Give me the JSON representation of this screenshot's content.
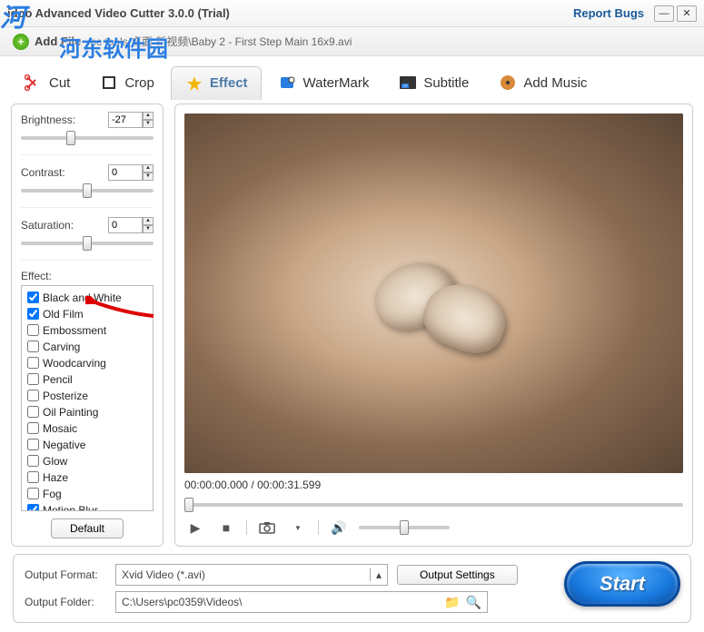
{
  "titlebar": {
    "title": "idoo Advanced Video Cutter 3.0.0 (Trial)",
    "report": "Report Bugs"
  },
  "watermark": {
    "logo": "河",
    "text": "河东软件园"
  },
  "addfile": {
    "label": "Add File",
    "path": "pc tools 桌面 新视频\\Baby 2 - First Step Main 16x9.avi"
  },
  "tabs": {
    "cut": "Cut",
    "crop": "Crop",
    "effect": "Effect",
    "watermark": "WaterMark",
    "subtitle": "Subtitle",
    "addmusic": "Add Music"
  },
  "sliders": {
    "brightness": {
      "label": "Brightness:",
      "value": "-27"
    },
    "contrast": {
      "label": "Contrast:",
      "value": "0"
    },
    "saturation": {
      "label": "Saturation:",
      "value": "0"
    }
  },
  "effect_section": {
    "label": "Effect:",
    "default_btn": "Default",
    "items": [
      {
        "name": "Black and White",
        "checked": true
      },
      {
        "name": "Old Film",
        "checked": true
      },
      {
        "name": "Embossment",
        "checked": false
      },
      {
        "name": "Carving",
        "checked": false
      },
      {
        "name": "Woodcarving",
        "checked": false
      },
      {
        "name": "Pencil",
        "checked": false
      },
      {
        "name": "Posterize",
        "checked": false
      },
      {
        "name": "Oil Painting",
        "checked": false
      },
      {
        "name": "Mosaic",
        "checked": false
      },
      {
        "name": "Negative",
        "checked": false
      },
      {
        "name": "Glow",
        "checked": false
      },
      {
        "name": "Haze",
        "checked": false
      },
      {
        "name": "Fog",
        "checked": false
      },
      {
        "name": "Motion Blur",
        "checked": true
      }
    ]
  },
  "preview": {
    "time": "00:00:00.000 / 00:00:31.599"
  },
  "footer": {
    "format_label": "Output Format:",
    "format_value": "Xvid Video (*.avi)",
    "output_settings": "Output Settings",
    "folder_label": "Output Folder:",
    "folder_value": "C:\\Users\\pc0359\\Videos\\",
    "start": "Start"
  }
}
